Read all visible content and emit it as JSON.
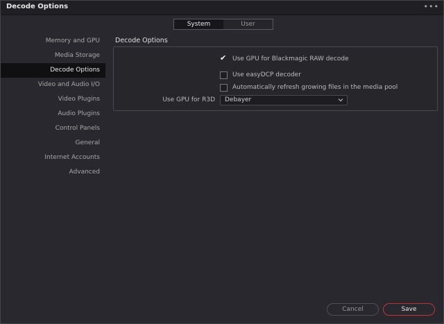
{
  "window": {
    "title": "Decode Options",
    "more_icon": "more-dots-icon"
  },
  "tabs": [
    {
      "label": "System",
      "active": true
    },
    {
      "label": "User",
      "active": false
    }
  ],
  "sidebar": {
    "items": [
      {
        "label": "Memory and GPU"
      },
      {
        "label": "Media Storage"
      },
      {
        "label": "Decode Options",
        "active": true
      },
      {
        "label": "Video and Audio I/O"
      },
      {
        "label": "Video Plugins"
      },
      {
        "label": "Audio Plugins"
      },
      {
        "label": "Control Panels"
      },
      {
        "label": "General"
      },
      {
        "label": "Internet Accounts"
      },
      {
        "label": "Advanced"
      }
    ]
  },
  "main": {
    "section_title": "Decode Options",
    "options": [
      {
        "label": "Use GPU for Blackmagic RAW decode",
        "checked": true
      },
      {
        "label": "Use easyDCP decoder",
        "checked": false
      },
      {
        "label": "Automatically refresh growing files in the media pool",
        "checked": false
      }
    ],
    "r3d": {
      "label": "Use GPU for R3D",
      "value": "Debayer"
    }
  },
  "footer": {
    "cancel_label": "Cancel",
    "save_label": "Save"
  },
  "colors": {
    "accent": "#c0353b",
    "background": "#28282e",
    "titlebar": "#1f1f24"
  }
}
